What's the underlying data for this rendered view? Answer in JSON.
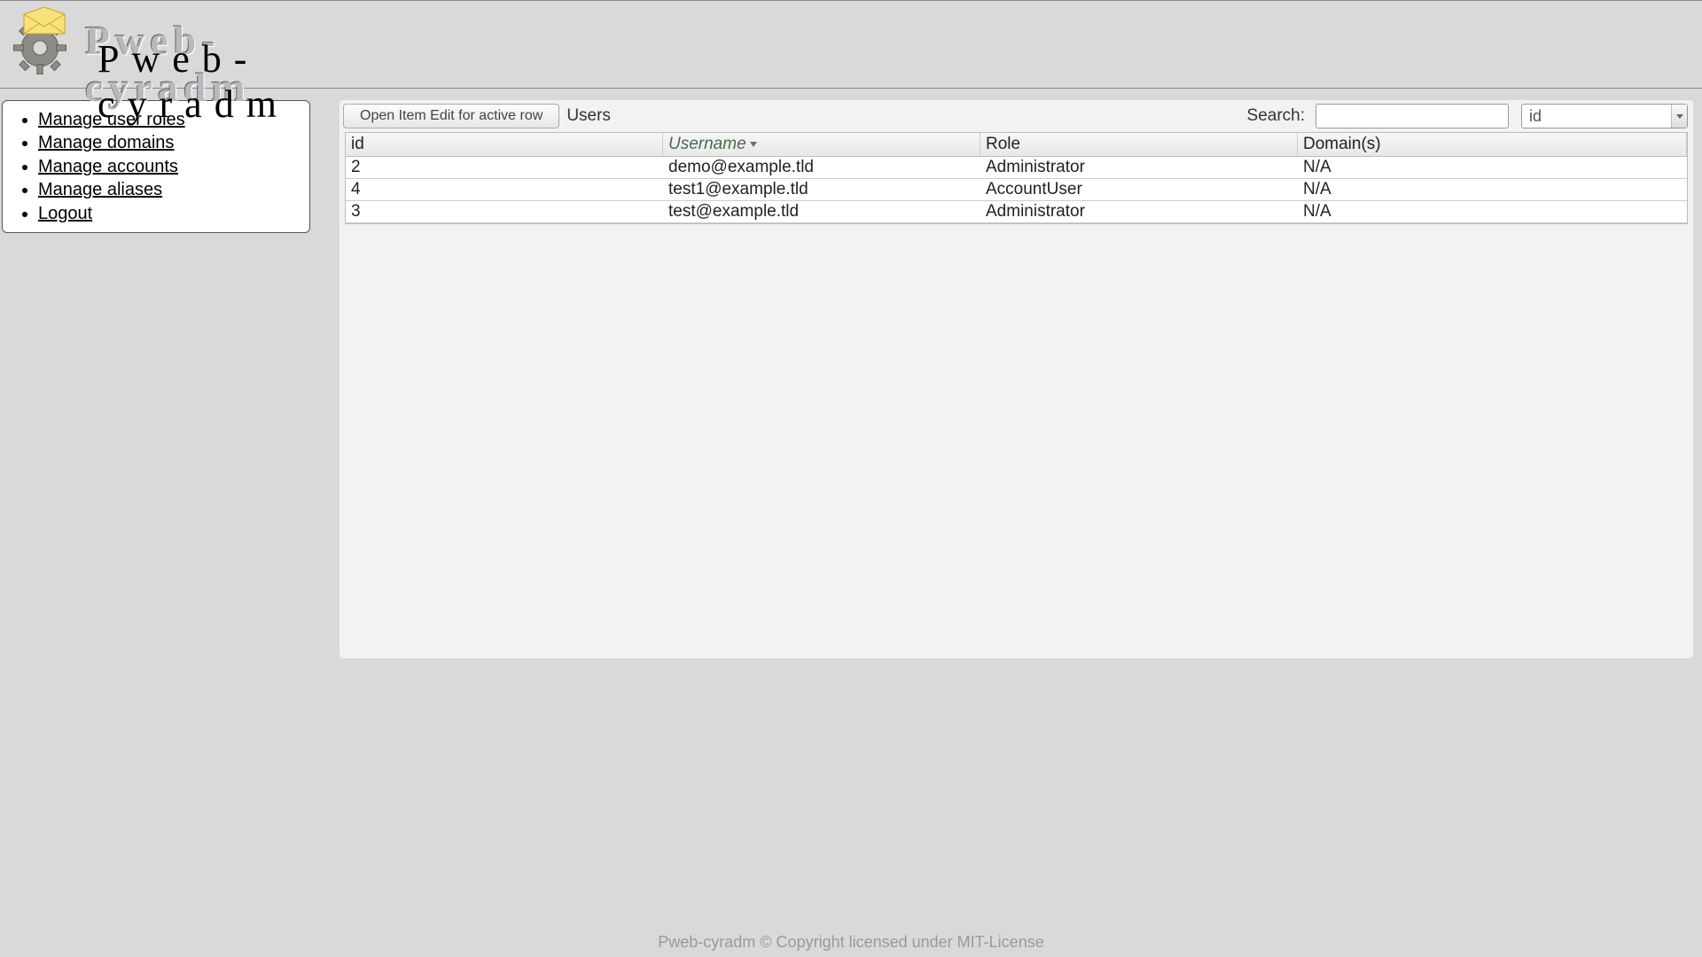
{
  "header": {
    "logo_text": "Pweb-cyradm",
    "title": "Pweb-cyradm"
  },
  "sidebar": {
    "items": [
      {
        "label": "Manage user roles"
      },
      {
        "label": "Manage domains"
      },
      {
        "label": "Manage accounts"
      },
      {
        "label": "Manage aliases"
      },
      {
        "label": "Logout"
      }
    ]
  },
  "toolbar": {
    "open_item_label": "Open Item Edit for active row",
    "panel_title": "Users",
    "search_label": "Search:",
    "search_value": "",
    "search_column": "id"
  },
  "grid": {
    "columns": [
      {
        "key": "id",
        "label": "id",
        "sorted": false
      },
      {
        "key": "username",
        "label": "Username",
        "sorted": true,
        "dir": "asc"
      },
      {
        "key": "role",
        "label": "Role",
        "sorted": false
      },
      {
        "key": "domains",
        "label": "Domain(s)",
        "sorted": false
      }
    ],
    "rows": [
      {
        "id": "2",
        "username": "demo@example.tld",
        "role": "Administrator",
        "domains": "N/A"
      },
      {
        "id": "4",
        "username": "test1@example.tld",
        "role": "AccountUser",
        "domains": "N/A"
      },
      {
        "id": "3",
        "username": "test@example.tld",
        "role": "Administrator",
        "domains": "N/A"
      }
    ]
  },
  "footer": {
    "text": "Pweb-cyradm © Copyright licensed under MIT-License"
  }
}
